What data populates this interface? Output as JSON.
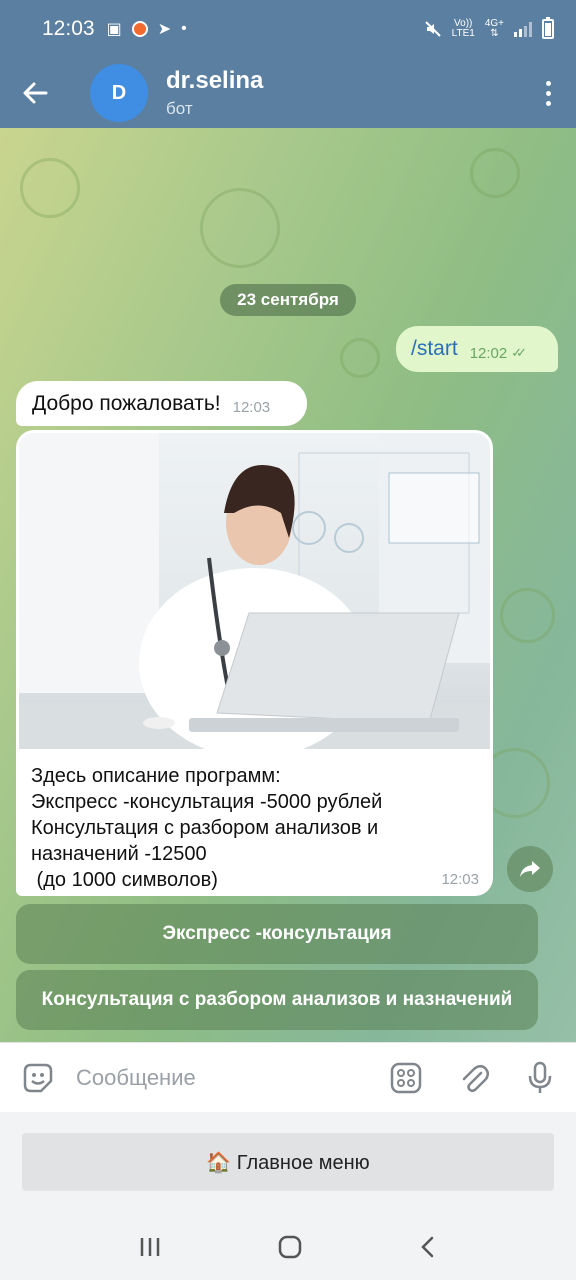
{
  "status": {
    "time": "12:03",
    "net_top": "Vo))",
    "net_bottom": "LTE1",
    "net_type": "4G+"
  },
  "header": {
    "name": "dr.selina",
    "subtitle": "бот",
    "avatar_letter": "D"
  },
  "date": "23 сентября",
  "messages": [
    {
      "text": "/start",
      "time": "12:02"
    },
    {
      "text": "Добро пожаловать!",
      "time": "12:03"
    },
    {
      "lines": [
        "Здесь описание программ:",
        "Экспресс -консультация -5000 рублей",
        "Консультация с разбором анализов и",
        "назначений -12500",
        " (до 1000 символов)"
      ],
      "time": "12:03"
    }
  ],
  "inline_buttons": [
    "Экспресс -консультация",
    "Консультация с разбором анализов и назначений"
  ],
  "input": {
    "placeholder": "Сообщение"
  },
  "keyboard": {
    "button": "🏠 Главное меню"
  }
}
